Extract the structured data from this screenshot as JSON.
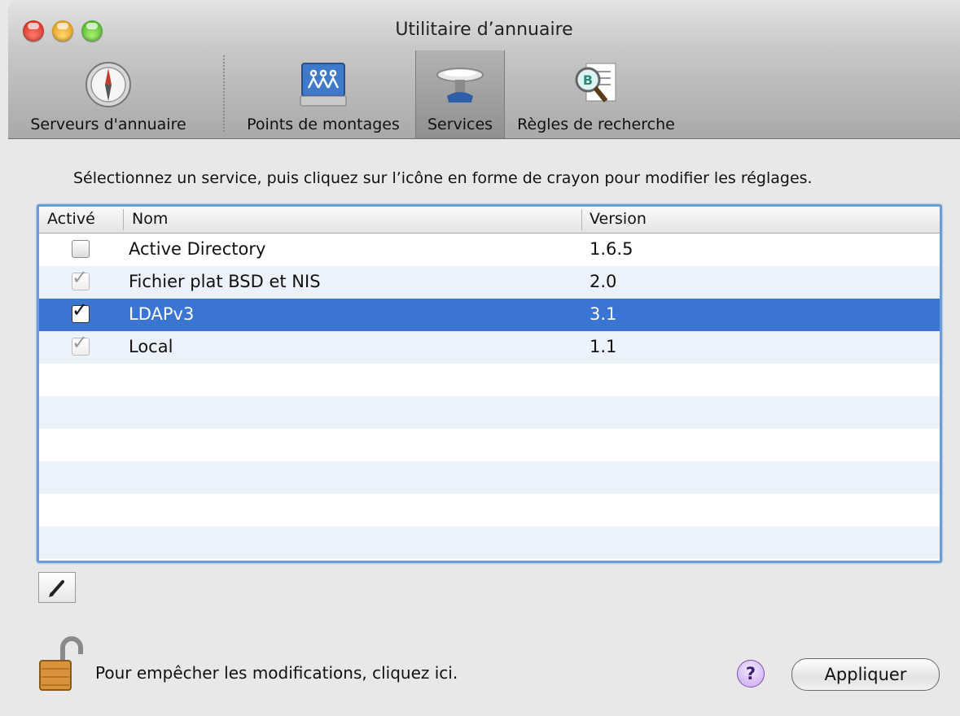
{
  "window": {
    "title": "Utilitaire d’annuaire"
  },
  "toolbar": {
    "items": [
      {
        "label": "Serveurs d'annuaire",
        "icon": "compass-icon"
      },
      {
        "label": "Points de montages",
        "icon": "drive-network-icon"
      },
      {
        "label": "Services",
        "icon": "services-plate-icon",
        "selected": true
      },
      {
        "label": "Règles de recherche",
        "icon": "search-policy-icon"
      }
    ]
  },
  "instruction": "Sélectionnez un service, puis cliquez sur l’icône en forme de crayon pour modifier les réglages.",
  "table": {
    "columns": {
      "active": "Activé",
      "name": "Nom",
      "version": "Version"
    },
    "rows": [
      {
        "enabled": false,
        "name": "Active Directory",
        "version": "1.6.5",
        "selected": false
      },
      {
        "enabled": true,
        "name": "Fichier plat BSD et NIS",
        "version": "2.0",
        "selected": false
      },
      {
        "enabled": true,
        "name": "LDAPv3",
        "version": "3.1",
        "selected": true
      },
      {
        "enabled": true,
        "name": "Local",
        "version": "1.1",
        "selected": false
      }
    ]
  },
  "bottom": {
    "lock_text": "Pour empêcher les modifications, cliquez ici.",
    "help": "?",
    "apply_label": "Appliquer"
  }
}
